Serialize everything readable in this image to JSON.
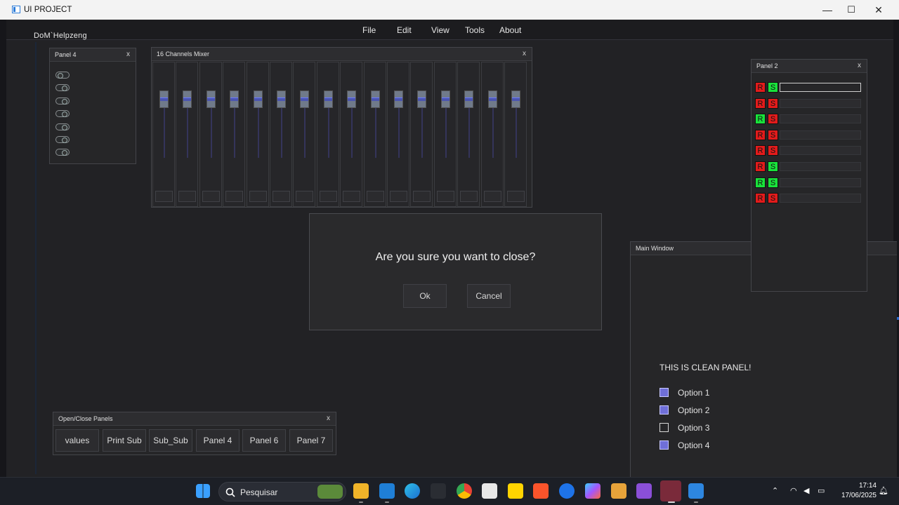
{
  "window": {
    "title": "UI PROJECT",
    "minimize": "—",
    "maximize": "☐",
    "close": "✕"
  },
  "app": {
    "brand": "DoM`Helpzeng"
  },
  "menu": [
    "File",
    "Edit",
    "View",
    "Tools",
    "About"
  ],
  "panel4": {
    "title": "Panel 4",
    "close": "x",
    "toggles": [
      false,
      true,
      true,
      true,
      true,
      true,
      true
    ]
  },
  "mixer": {
    "title": "16 Channels Mixer",
    "close": "x",
    "channel_count": 16
  },
  "panel2": {
    "title": "Panel 2",
    "close": "x",
    "r_label": "R",
    "s_label": "S",
    "rows": [
      {
        "r": "red",
        "s": "green"
      },
      {
        "r": "red",
        "s": "red"
      },
      {
        "r": "green",
        "s": "red"
      },
      {
        "r": "red",
        "s": "red"
      },
      {
        "r": "red",
        "s": "red"
      },
      {
        "r": "red",
        "s": "green"
      },
      {
        "r": "green",
        "s": "green"
      },
      {
        "r": "red",
        "s": "red"
      }
    ]
  },
  "modal": {
    "message": "Are you sure you want to close?",
    "ok": "Ok",
    "cancel": "Cancel"
  },
  "main_window": {
    "title": "Main Window",
    "clean_title": "THIS IS CLEAN PANEL!",
    "options": [
      {
        "label": "Option 1",
        "checked": true
      },
      {
        "label": "Option 2",
        "checked": true
      },
      {
        "label": "Option 3",
        "checked": false
      },
      {
        "label": "Option 4",
        "checked": true
      }
    ]
  },
  "open_close": {
    "title": "Open/Close Panels",
    "close": "x",
    "buttons": [
      "values",
      "Print Sub",
      "Sub_Sub",
      "Panel 4",
      "Panel 6",
      "Panel 7"
    ]
  },
  "taskbar": {
    "search_placeholder": "Pesquisar",
    "time": "17:14",
    "date": "17/06/2025"
  },
  "colors": {
    "toggle_on": "#2a2c2e",
    "red": "#e21b1b",
    "green": "#19e23b",
    "checkbox": "#6f6fd8",
    "accent": "#2b6bd0"
  }
}
